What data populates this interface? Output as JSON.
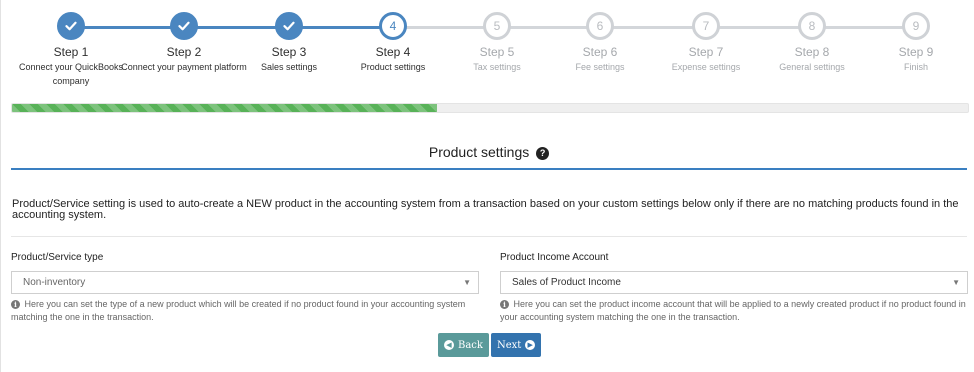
{
  "stepper": {
    "steps": [
      {
        "number": "1",
        "title": "Step 1",
        "subtitle": "Connect your QuickBooks company",
        "state": "done"
      },
      {
        "number": "2",
        "title": "Step 2",
        "subtitle": "Connect your payment platform",
        "state": "done"
      },
      {
        "number": "3",
        "title": "Step 3",
        "subtitle": "Sales settings",
        "state": "done"
      },
      {
        "number": "4",
        "title": "Step 4",
        "subtitle": "Product settings",
        "state": "current"
      },
      {
        "number": "5",
        "title": "Step 5",
        "subtitle": "Tax settings",
        "state": "todo"
      },
      {
        "number": "6",
        "title": "Step 6",
        "subtitle": "Fee settings",
        "state": "todo"
      },
      {
        "number": "7",
        "title": "Step 7",
        "subtitle": "Expense settings",
        "state": "todo"
      },
      {
        "number": "8",
        "title": "Step 8",
        "subtitle": "General settings",
        "state": "todo"
      },
      {
        "number": "9",
        "title": "Step 9",
        "subtitle": "Finish",
        "state": "todo"
      }
    ],
    "done_icon": "check-icon"
  },
  "progress": {
    "fraction": 0.445,
    "color": "#58b258"
  },
  "section": {
    "title": "Product settings",
    "help_icon": "question-circle-icon",
    "description": "Product/Service setting is used to auto-create a NEW product in the accounting system from a transaction based on your custom settings below only if there are no matching products found in the accounting system."
  },
  "form": {
    "product_type": {
      "label": "Product/Service type",
      "value": "Non-inventory",
      "help": "Here you can set the type of a new product which will be created if no product found in your accounting system matching the one in the transaction."
    },
    "income_account": {
      "label": "Product Income Account",
      "value": "Sales of Product Income",
      "help": "Here you can set the product income account that will be applied to a newly created product if no product found in your accounting system matching the one in the transaction."
    },
    "info_icon": "info-circle-icon"
  },
  "buttons": {
    "back": "Back",
    "next": "Next",
    "back_icon": "arrow-circle-left-icon",
    "next_icon": "arrow-circle-right-icon"
  },
  "colors": {
    "accent": "#4a86c0",
    "inactive": "#cfd2d6",
    "back_button": "#5a9a9a",
    "next_button": "#3373ae"
  }
}
